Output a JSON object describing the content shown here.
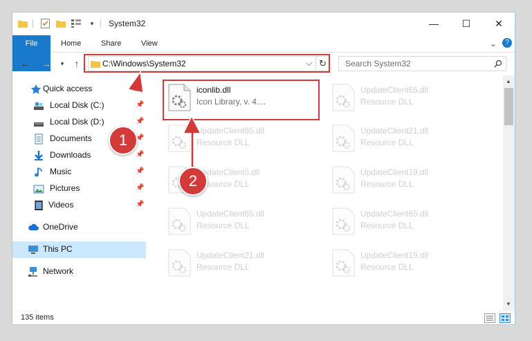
{
  "window": {
    "title": "System32",
    "minimize_glyph": "—",
    "maximize_glyph": "☐",
    "close_glyph": "✕"
  },
  "ribbon": {
    "tabs": [
      "File",
      "Home",
      "Share",
      "View"
    ]
  },
  "address": {
    "path": "C:\\Windows\\System32",
    "refresh_glyph": "↻",
    "dropdown_glyph": "⌵"
  },
  "search": {
    "placeholder": "Search System32"
  },
  "nav": {
    "quick_access": "Quick access",
    "items": [
      {
        "label": "Local Disk (C:)",
        "icon": "drive-icon"
      },
      {
        "label": "Local Disk (D:)",
        "icon": "drive-icon"
      },
      {
        "label": "Documents",
        "icon": "documents-icon"
      },
      {
        "label": "Downloads",
        "icon": "downloads-icon"
      },
      {
        "label": "Music",
        "icon": "music-icon"
      },
      {
        "label": "Pictures",
        "icon": "pictures-icon"
      },
      {
        "label": "Videos",
        "icon": "videos-icon"
      }
    ],
    "onedrive": "OneDrive",
    "this_pc": "This PC",
    "network": "Network"
  },
  "files": {
    "highlighted": {
      "name": "iconlib.dll",
      "desc": "Icon Library, v. 4...."
    },
    "col1": [
      {
        "name": "UpdateClient65.dll",
        "desc": "Resource DLL"
      },
      {
        "name": "UpdateClient5.dll",
        "desc": "Resource DLL"
      },
      {
        "name": "UpdateClient65.dll",
        "desc": "Resource DLL"
      },
      {
        "name": "UpdateClient21.dll",
        "desc": "Resource DLL"
      }
    ],
    "col2": [
      {
        "name": "UpdateClient65.dll",
        "desc": "Resource DLL"
      },
      {
        "name": "UpdateClient21.dll",
        "desc": "Resource DLL"
      },
      {
        "name": "UpdateClient19.dll",
        "desc": "Resource DLL"
      },
      {
        "name": "UpdateClient65.dll",
        "desc": "Resource DLL"
      },
      {
        "name": "UpdateClient19.dll",
        "desc": "Resource DLL"
      }
    ]
  },
  "status": {
    "count": "135 items"
  },
  "annotations": {
    "step1": "1",
    "step2": "2",
    "color": "#d23a3a"
  }
}
